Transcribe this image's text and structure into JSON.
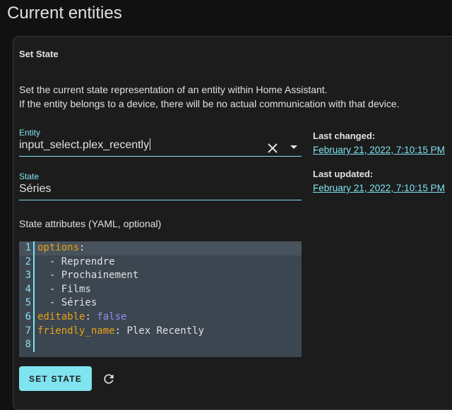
{
  "page": {
    "title": "Current entities"
  },
  "card": {
    "title": "Set State",
    "description_line1": "Set the current state representation of an entity within Home Assistant.",
    "description_line2": "If the entity belongs to a device, there will be no actual communication with that device."
  },
  "entity_field": {
    "label": "Entity",
    "value": "input_select.plex_recently",
    "clear_icon": "close-icon",
    "dropdown_icon": "chevron-down-icon"
  },
  "state_field": {
    "label": "State",
    "value": "Séries"
  },
  "last_changed": {
    "label": "Last changed:",
    "value": "February 21, 2022, 7:10:15 PM"
  },
  "last_updated": {
    "label": "Last updated:",
    "value": "February 21, 2022, 7:10:15 PM"
  },
  "attributes": {
    "label": "State attributes (YAML, optional)",
    "lines": [
      {
        "num": "1",
        "key": "options",
        "sep": ":",
        "val": ""
      },
      {
        "num": "2",
        "key": "",
        "sep": "",
        "val": "  - Reprendre"
      },
      {
        "num": "3",
        "key": "",
        "sep": "",
        "val": "  - Prochainement"
      },
      {
        "num": "4",
        "key": "",
        "sep": "",
        "val": "  - Films"
      },
      {
        "num": "5",
        "key": "",
        "sep": "",
        "val": "  - Séries"
      },
      {
        "num": "6",
        "key": "editable",
        "sep": ": ",
        "val": "false"
      },
      {
        "num": "7",
        "key": "friendly_name",
        "sep": ": ",
        "val": "Plex Recently"
      },
      {
        "num": "8",
        "key": "",
        "sep": "",
        "val": ""
      }
    ]
  },
  "actions": {
    "set_state_label": "SET STATE",
    "refresh_icon": "refresh-icon"
  },
  "colors": {
    "accent": "#7fe3f0",
    "yaml_key": "#e8a317",
    "yaml_bool": "#8f8ff0",
    "editor_bg": "#3c4650",
    "card_bg": "#1c1c1c",
    "page_bg": "#111111"
  }
}
